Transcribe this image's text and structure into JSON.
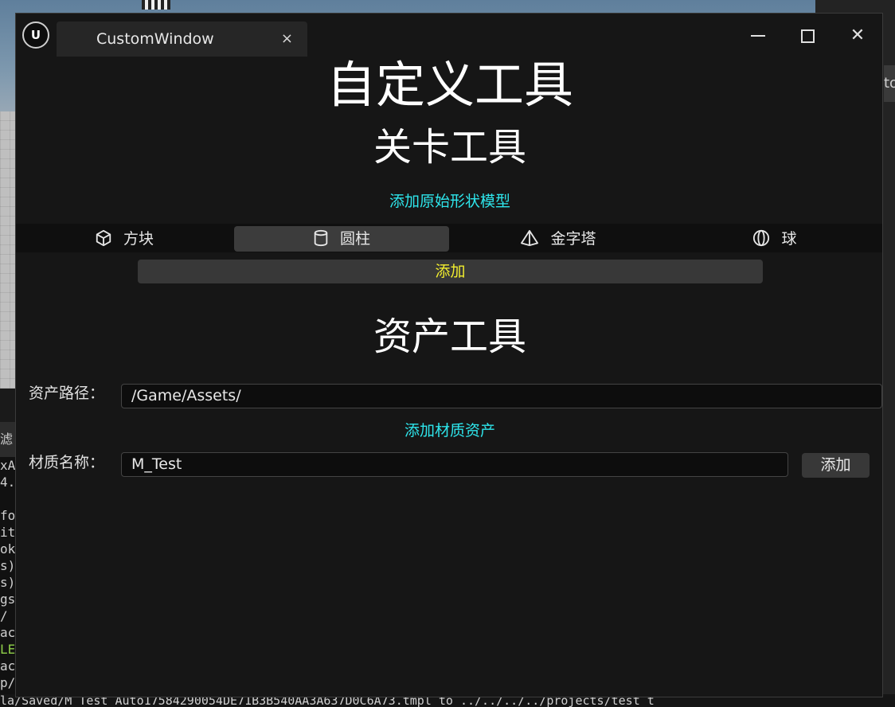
{
  "background": {
    "right_button_text": "to",
    "console_tab_label": "滤",
    "console_lines": [
      "xA",
      "4.",
      "",
      "fo",
      "it",
      "ok",
      "s)",
      "s)",
      "gs",
      " /",
      "ac",
      "LE",
      "ac",
      "p/"
    ],
    "status_line": "la/Saved/M_Test_Auto17584290054DE71B3B540AA3A637D0C6A73.tmpl to ../../../../projects/test_t"
  },
  "window": {
    "logo_text": "U",
    "tab_title": "CustomWindow",
    "tab_close": "×",
    "close_symbol": "✕"
  },
  "main": {
    "title": "自定义工具",
    "level_section": {
      "title": "关卡工具",
      "primitive_link": "添加原始形状模型",
      "shapes": [
        {
          "label": "方块",
          "icon": "cube-icon",
          "active": false
        },
        {
          "label": "圆柱",
          "icon": "cylinder-icon",
          "active": true
        },
        {
          "label": "金字塔",
          "icon": "pyramid-icon",
          "active": false
        },
        {
          "label": "球",
          "icon": "sphere-icon",
          "active": false
        }
      ],
      "add_button": "添加"
    },
    "asset_section": {
      "title": "资产工具",
      "path_label": "资产路径：",
      "path_value": "/Game/Assets/",
      "material_link": "添加材质资产",
      "material_label": "材质名称：",
      "material_value": "M_Test",
      "add_button": "添加"
    }
  },
  "colors": {
    "accent_cyan": "#2ee6ec",
    "add_text_yellow": "#f2ee2e",
    "window_bg": "#161616"
  }
}
